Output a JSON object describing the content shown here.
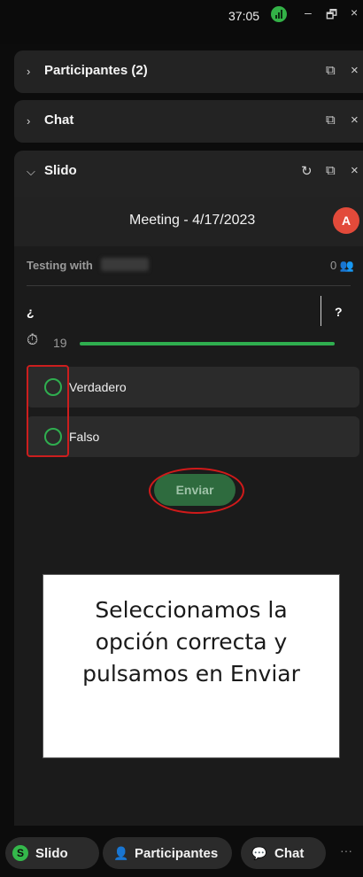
{
  "titlebar": {
    "timer": "37:05",
    "minimize": "–",
    "restore": "🗗",
    "close": "×"
  },
  "panels": {
    "participantes": {
      "chevron": "›",
      "title": "Participantes (2)",
      "popout_icon": "⧉",
      "close_icon": "×"
    },
    "chat": {
      "chevron": "›",
      "title": "Chat",
      "popout_icon": "⧉",
      "close_icon": "×"
    },
    "slido": {
      "chevron": "⌵",
      "title": "Slido",
      "refresh_icon": "↻",
      "popout_icon": "⧉",
      "close_icon": "×"
    }
  },
  "slido": {
    "meeting_title": "Meeting - 4/17/2023",
    "avatar_initial": "A",
    "event_label": "Testing with",
    "participant_count": "0",
    "participants_icon": "👥",
    "question_start": "¿",
    "question_end": "?",
    "timer_icon": "⏱",
    "timer_value": "19",
    "timer_progress": 1.0,
    "options": [
      {
        "label": "Verdadero"
      },
      {
        "label": "Falso"
      }
    ],
    "submit_label": "Enviar"
  },
  "callout": {
    "text": "Seleccionamos la\nopción correcta y\npulsamos en Enviar"
  },
  "dock": {
    "slido_icon_letter": "S",
    "slido_label": "Slido",
    "participantes_icon": "👤",
    "participantes_label": "Participantes",
    "chat_icon": "💬",
    "chat_label": "Chat",
    "more_label": "···"
  },
  "colors": {
    "accent_green": "#2fae4f",
    "annotation_red": "#cc1e1e",
    "avatar_red": "#e24a3a",
    "panel_bg": "#232323"
  }
}
